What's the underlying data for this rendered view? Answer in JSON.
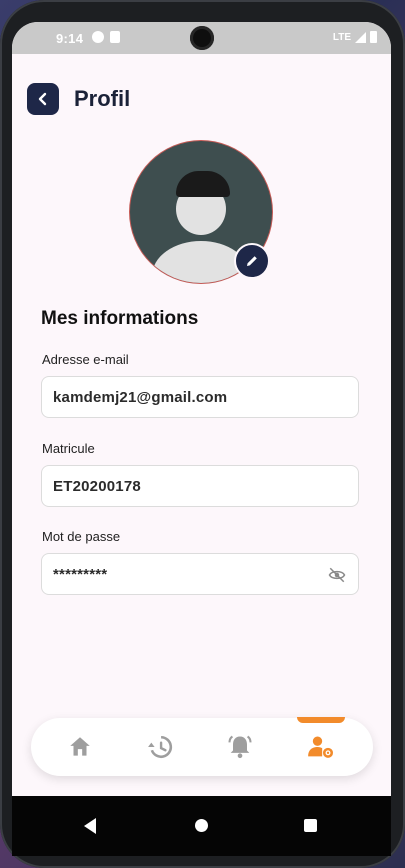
{
  "status_bar": {
    "time": "9:14",
    "network": "LTE"
  },
  "header": {
    "title": "Profil"
  },
  "profile": {
    "section_title": "Mes informations",
    "fields": [
      {
        "label": "Adresse e-mail",
        "value": "kamdemj21@gmail.com"
      },
      {
        "label": "Matricule",
        "value": "ET20200178"
      },
      {
        "label": "Mot de passe",
        "value": "*********"
      }
    ]
  },
  "bottom_nav": {
    "items": [
      {
        "icon": "home-icon",
        "active": false
      },
      {
        "icon": "history-icon",
        "active": false
      },
      {
        "icon": "bell-icon",
        "active": false
      },
      {
        "icon": "user-settings-icon",
        "active": true
      }
    ]
  },
  "colors": {
    "primary": "#1e2748",
    "accent": "#f28b2b",
    "inactive_icon": "#9e9e9e",
    "background": "#fdf7fb"
  }
}
